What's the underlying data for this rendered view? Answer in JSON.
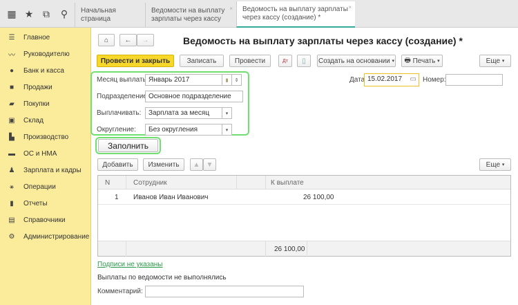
{
  "topbar": {
    "icons": [
      "apps-grid-icon",
      "star-icon",
      "history-icon",
      "search-icon"
    ],
    "tabs": [
      {
        "label": "Начальная страница"
      },
      {
        "label": "Ведомости на выплату зарплаты через кассу"
      },
      {
        "label": "Ведомость на выплату зарплаты через кассу (создание) *"
      }
    ]
  },
  "sidebar": {
    "items": [
      {
        "label": "Главное",
        "icon": "menu-icon"
      },
      {
        "label": "Руководителю",
        "icon": "chart-line-icon"
      },
      {
        "label": "Банк и касса",
        "icon": "coin-icon"
      },
      {
        "label": "Продажи",
        "icon": "bag-icon"
      },
      {
        "label": "Покупки",
        "icon": "cart-icon"
      },
      {
        "label": "Склад",
        "icon": "warehouse-icon"
      },
      {
        "label": "Производство",
        "icon": "factory-icon"
      },
      {
        "label": "ОС и НМА",
        "icon": "truck-icon"
      },
      {
        "label": "Зарплата и кадры",
        "icon": "people-icon"
      },
      {
        "label": "Операции",
        "icon": "operations-icon"
      },
      {
        "label": "Отчеты",
        "icon": "report-icon"
      },
      {
        "label": "Справочники",
        "icon": "book-icon"
      },
      {
        "label": "Администрирование",
        "icon": "gear-icon"
      }
    ]
  },
  "form": {
    "title": "Ведомость на выплату зарплаты через кассу (создание) *",
    "toolbar": {
      "post_close": "Провести и закрыть",
      "save": "Записать",
      "post": "Провести",
      "create_based": "Создать на основании",
      "print": "Печать",
      "more": "Еще"
    },
    "month_label": "Месяц выплаты:",
    "month_value": "Январь 2017",
    "date_label": "Дата:",
    "date_value": "15.02.2017",
    "number_label": "Номер:",
    "number_value": "",
    "dept_label": "Подразделение:",
    "dept_value": "Основное подразделение",
    "pay_label": "Выплачивать:",
    "pay_value": "Зарплата за месяц",
    "round_label": "Округление:",
    "round_value": "Без округления",
    "fill": "Заполнить",
    "table_toolbar": {
      "add": "Добавить",
      "edit": "Изменить",
      "more": "Еще"
    },
    "table": {
      "headers": [
        "N",
        "Сотрудник",
        "К выплате"
      ],
      "rows": [
        {
          "n": "1",
          "employee": "Иванов Иван Иванович",
          "amount": "26 100,00"
        }
      ],
      "total": "26 100,00"
    },
    "signatures_link": "Подписи не указаны",
    "payments_status": "Выплаты по ведомости не выполнялись",
    "comment_label": "Комментарий:",
    "comment_value": ""
  }
}
